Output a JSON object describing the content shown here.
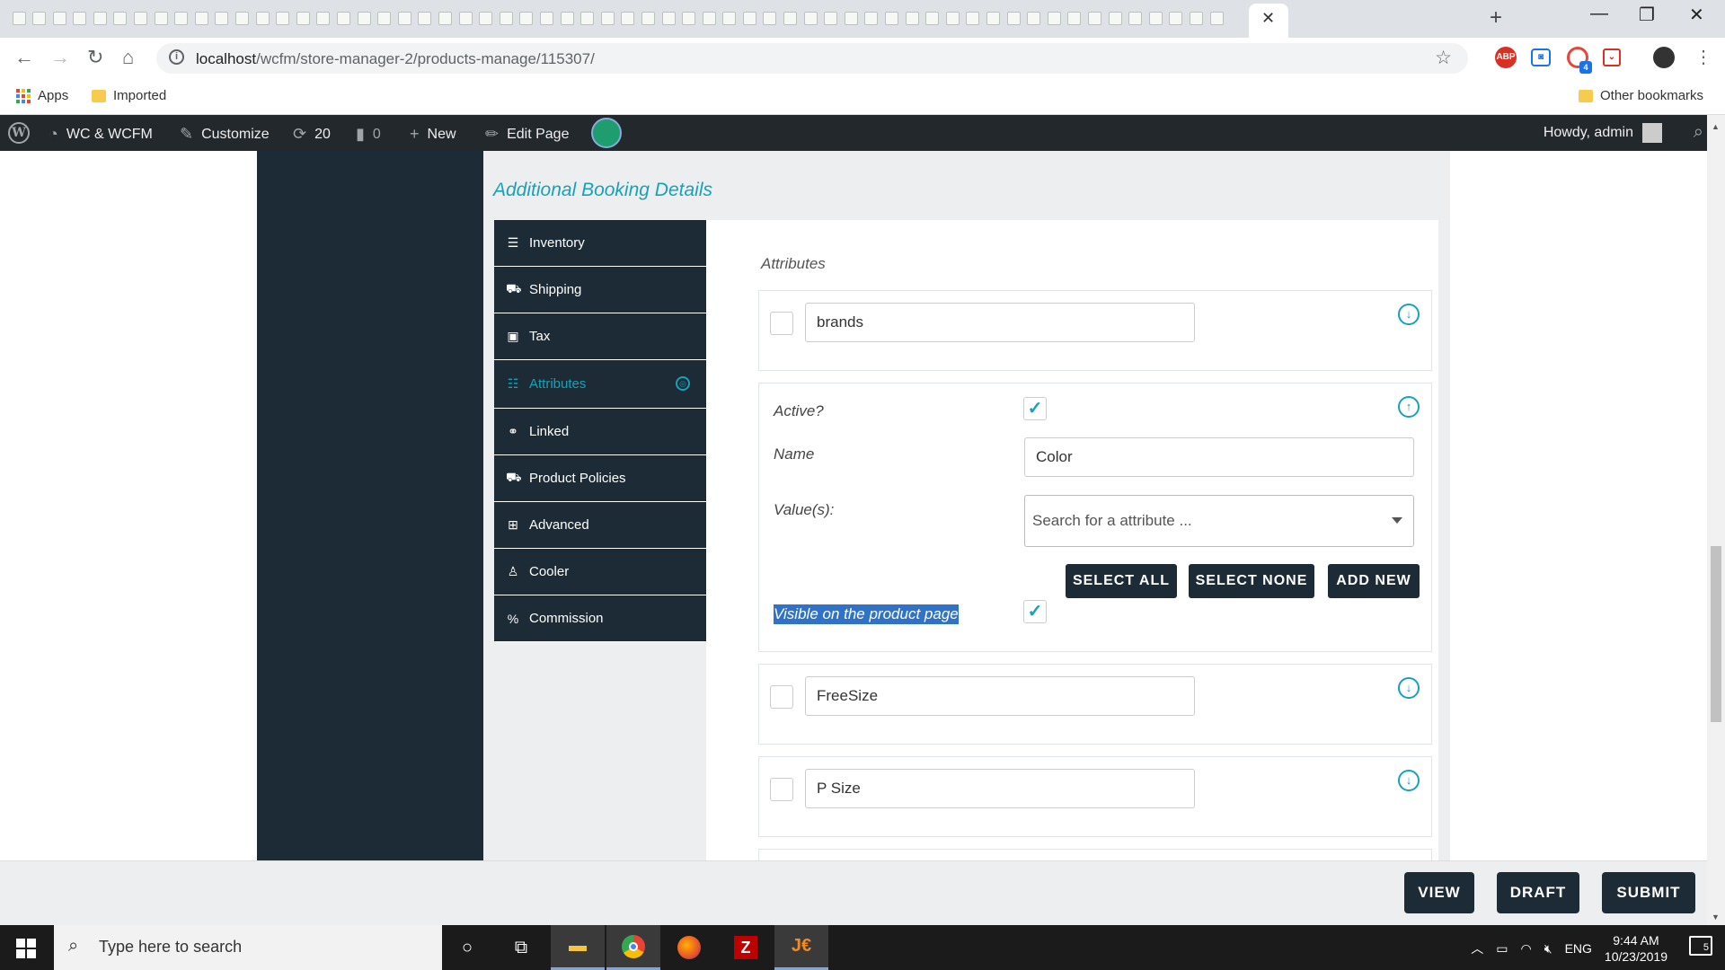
{
  "browser": {
    "active_tab_close": "✕",
    "new_tab": "+",
    "window": {
      "minimize": "—",
      "maximize": "❐",
      "close": "✕"
    },
    "url_host": "localhost",
    "url_path": "/wcfm/store-manager-2/products-manage/115307/",
    "extension_badge": "4",
    "bookmarks": {
      "apps": "Apps",
      "imported": "Imported",
      "other": "Other bookmarks"
    }
  },
  "wpbar": {
    "site": "WC & WCFM",
    "customize": "Customize",
    "updates": "20",
    "comments": "0",
    "new": "New",
    "edit_page": "Edit Page",
    "howdy": "Howdy, admin"
  },
  "section_title": "Additional Booking Details",
  "tabs": [
    {
      "label": "Inventory",
      "icon": "database-icon"
    },
    {
      "label": "Shipping",
      "icon": "truck-icon"
    },
    {
      "label": "Tax",
      "icon": "money-icon"
    },
    {
      "label": "Attributes",
      "icon": "list-icon",
      "active": true
    },
    {
      "label": "Linked",
      "icon": "link-icon"
    },
    {
      "label": "Product Policies",
      "icon": "policy-icon"
    },
    {
      "label": "Advanced",
      "icon": "grid-icon"
    },
    {
      "label": "Cooler",
      "icon": "user-icon"
    },
    {
      "label": "Commission",
      "icon": "percent-icon"
    }
  ],
  "attributes_heading": "Attributes",
  "attributes": {
    "brands": {
      "name": "brands",
      "checked": false
    },
    "color": {
      "active_label": "Active?",
      "active": true,
      "name_label": "Name",
      "name": "Color",
      "values_label": "Value(s):",
      "values_placeholder": "Search for a attribute ...",
      "select_all": "SELECT ALL",
      "select_none": "SELECT NONE",
      "add_new": "ADD NEW",
      "visible_label": "Visible on the product page",
      "visible": true
    },
    "freesize": {
      "name": "FreeSize",
      "checked": false
    },
    "psize": {
      "name": "P Size",
      "checked": false
    }
  },
  "actions": {
    "view": "VIEW",
    "draft": "DRAFT",
    "submit": "SUBMIT"
  },
  "taskbar": {
    "search_placeholder": "Type here to search",
    "language": "ENG",
    "time": "9:44 AM",
    "date": "10/23/2019",
    "notifications": "5"
  },
  "colors": {
    "accent": "#17a2b8",
    "dark": "#1c2b36",
    "wpbar": "#23282d"
  }
}
